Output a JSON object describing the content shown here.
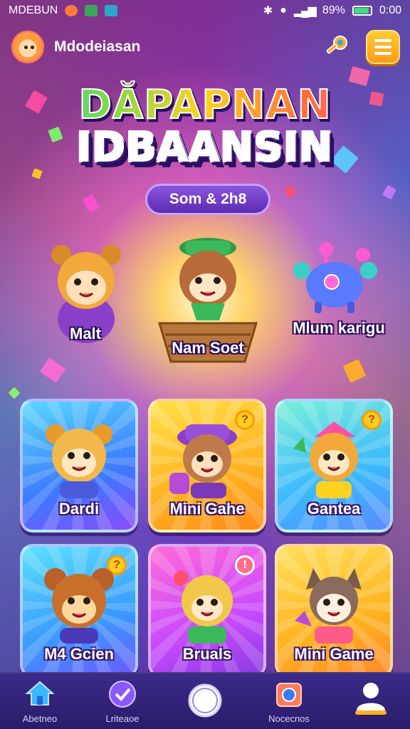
{
  "status_bar": {
    "carrier": "MDEBUN",
    "battery": "89%",
    "time": "0:00"
  },
  "header": {
    "username": "Mdodeiasan"
  },
  "title": {
    "line1": "DĂPAPNAN",
    "line2": "IDBAANSIN"
  },
  "pill": {
    "text": "Som & 2h8"
  },
  "featured": [
    {
      "label": "Malt"
    },
    {
      "label": "Nam Soet"
    },
    {
      "label": "Mlum karigu"
    }
  ],
  "cards": [
    {
      "label": "Dardi",
      "badge": ""
    },
    {
      "label": "Mini Gahe",
      "badge": "?"
    },
    {
      "label": "Gantea",
      "badge": "?"
    },
    {
      "label": "M4 Gcien",
      "badge": "?"
    },
    {
      "label": "Bruals",
      "badge": "!"
    },
    {
      "label": "Mini Game",
      "badge": ""
    }
  ],
  "bottom_nav": [
    {
      "label": "Abetneo",
      "icon": "home-icon"
    },
    {
      "label": "Lriteaoe",
      "icon": "check-badge-icon"
    },
    {
      "label": "",
      "icon": "center-circle-icon"
    },
    {
      "label": "Nocecnos",
      "icon": "camera-icon"
    },
    {
      "label": "",
      "icon": "profile-icon"
    }
  ],
  "colors": {
    "accent_orange": "#ff9a1a",
    "pill_purple": "#6a35c8",
    "nav_bg": "#2f1f76"
  }
}
